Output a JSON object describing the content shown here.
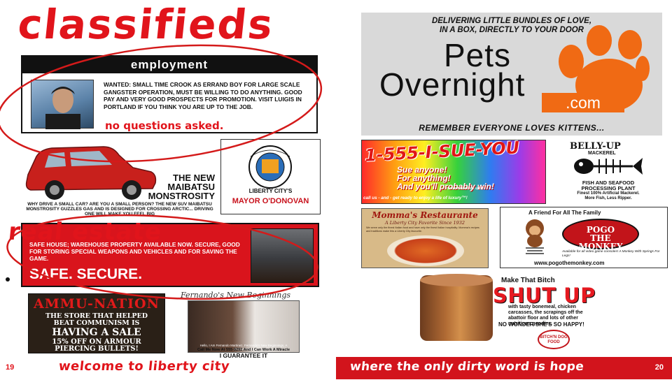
{
  "left_page": {
    "title": "classifieds",
    "employment": {
      "header": "employment",
      "body": "WANTED: SMALL TIME CROOK AS ERRAND BOY FOR LARGE SCALE GANGSTER OPERATION, MUST BE WILLING TO DO ANYTHING. GOOD PAY AND VERY GOOD PROSPECTS FOR PROMOTION. VISIT LUIGIS IN PORTLAND IF YOU THINK YOU ARE UP TO THE JOB.",
      "tagline": "no questions asked."
    },
    "suv_ad": {
      "title_line1": "THE NEW",
      "title_line2": "MAIBATSU",
      "title_line3": "MONSTROSITY",
      "body": "WHY DRIVE A SMALL CAR? ARE YOU A SMALL PERSON? THE NEW SUV MAIBATSU MONSTROSITY GUZZLES GAS AND IS DESIGNED FOR CROSSING ARCTIC... DRIVING ONE WILL MAKE YOU FEEL BIG"
    },
    "city_ad": {
      "seal_text": "THE CITY OF LIBERTY",
      "seal_bottom": "MAYORS OFFICE",
      "caption": "LIBERTY CITY'S",
      "name": "MAYOR O'DONOVAN"
    },
    "real_estate": {
      "header": "real estate",
      "body": "SAFE HOUSE; WAREHOUSE PROPERTY AVAILABLE NOW. SECURE, GOOD FOR STORING SPECIAL WEAPONS AND VEHICLES AND FOR SAVING THE GAME.",
      "slogan": "SAFE.  SECURE."
    },
    "ammu_nation": {
      "name": "AMMU-NATION",
      "line1": "THE STORE THAT HELPED",
      "line1b": "BEAT COMMUNISM IS",
      "line2": "HAVING A SALE",
      "line3": "15% OFF ON ARMOUR",
      "line3b": "PIERCING BULLETS!"
    },
    "fernando": {
      "heading": "Fernando's New Beginnings",
      "photo_caption": "Hello, I Am Fernando Martinez, Fernando's New Beginnings, A Revolutionary",
      "call": "Call Me Now At 555-9292 And I Can Work A Miracle",
      "guarantee": "I GUARANTEE IT"
    },
    "footer": {
      "page_number": "19",
      "text": "welcome to liberty city"
    }
  },
  "right_page": {
    "pets_overnight": {
      "tagline_top1": "DELIVERING LITTLE BUNDLES OF LOVE,",
      "tagline_top2": "IN A BOX, DIRECTLY TO YOUR DOOR",
      "logo_line1": "Pets",
      "logo_line2": "Overnight",
      "logo_domain": ".com",
      "tagline_bottom": "REMEMBER EVERYONE LOVES KITTENS..."
    },
    "sue_you": {
      "number": "1-555-I-SUE-YOU",
      "line1": "Sue anyone!",
      "line2": "For anything!",
      "line3": "And you'll probably win!",
      "small": "*certain restrictions apply",
      "footer": "call us - and - get ready to enjoy a life of luxury™!"
    },
    "belly_up": {
      "logo": "BELLY-UP",
      "logo_sub": "MACKEREL",
      "line1": "FISH AND SEAFOOD",
      "line2": "PROCESSING PLANT",
      "line3": "Finest 100% Artificial Mackerel.",
      "line4": "More Fish, Less Ripper."
    },
    "mommas": {
      "name": "Momma's Restaurante",
      "sub": "A Liberty City Favorite Since 1932",
      "body": "We serve only the finest Italian food and have only the finest Italian hospitality. Momma's recipes and traditions make this a Liberty City favourite."
    },
    "pogo": {
      "tag": "A Friend For All The Family",
      "logo_line1": "POGO",
      "logo_line2": "THE",
      "logo_line3": "MONKEY",
      "small": "Available for all video game consoles! A Monkey With Springs For Legs!",
      "url": "www.pogothemonkey.com"
    },
    "dog_food": {
      "make": "Make That Bitch",
      "headline": "SHUT UP",
      "desc": "with tasty bonemeal, chicken carcasses, the scrapings off the abattoir floor and lots of other nutritious goodies.",
      "happy": "NO WONDER SHE'S SO HAPPY!",
      "logo": "BITCH'N DOG FOOD"
    },
    "footer": {
      "text": "where the only dirty word is hope",
      "page_number": "20"
    }
  },
  "colors": {
    "accent_red": "#e1141b",
    "pets_orange": "#f06a14",
    "pets_bg": "#d9d9d9"
  }
}
